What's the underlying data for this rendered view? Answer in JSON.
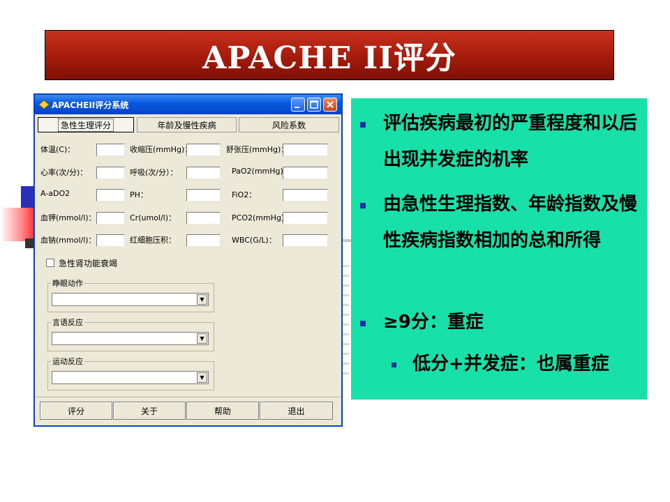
{
  "banner": {
    "title": "APACHE II评分"
  },
  "dialog": {
    "title": "APACHEII评分系统",
    "tabs": [
      {
        "label": "急性生理评分"
      },
      {
        "label": "年龄及慢性疾病"
      },
      {
        "label": "风险系数"
      }
    ],
    "fields": [
      {
        "label": "体温(C)："
      },
      {
        "label": "收缩压(mmHg)："
      },
      {
        "label": "舒张压(mmHg)："
      },
      {
        "label": "心率(次/分)："
      },
      {
        "label": "呼吸(次/分）："
      },
      {
        "label": "PaO2(mmHg)"
      },
      {
        "label": "A-aDO2"
      },
      {
        "label": "PH："
      },
      {
        "label": "FiO2："
      },
      {
        "label": "血钾(mmol/l)："
      },
      {
        "label": "Cr(umol/l)："
      },
      {
        "label": "PCO2(mmHg)："
      },
      {
        "label": "血钠(mmol/l)："
      },
      {
        "label": "红细胞压积："
      },
      {
        "label": "WBC(G/L)："
      }
    ],
    "checkbox_label": "急性肾功能衰竭",
    "groups": [
      {
        "label": "睁眼动作"
      },
      {
        "label": "言语反应"
      },
      {
        "label": "运动反应"
      }
    ],
    "buttons": {
      "score": "评分",
      "about": "关于",
      "help": "帮助",
      "exit": "退出"
    }
  },
  "bullets": [
    {
      "text": "评估疾病最初的严重程度和以后出现并发症的机率"
    },
    {
      "text": "由急性生理指数、年龄指数及慢性疾病指数相加的总和所得"
    },
    {
      "text": "≥9分：重症"
    },
    {
      "text": "低分+并发症：也属重症"
    }
  ],
  "colors": {
    "banner": "#a81c0c",
    "panel": "#17e0a8",
    "bullet_marker": "#1e2fa8",
    "titlebar": "#0a5ae0"
  }
}
